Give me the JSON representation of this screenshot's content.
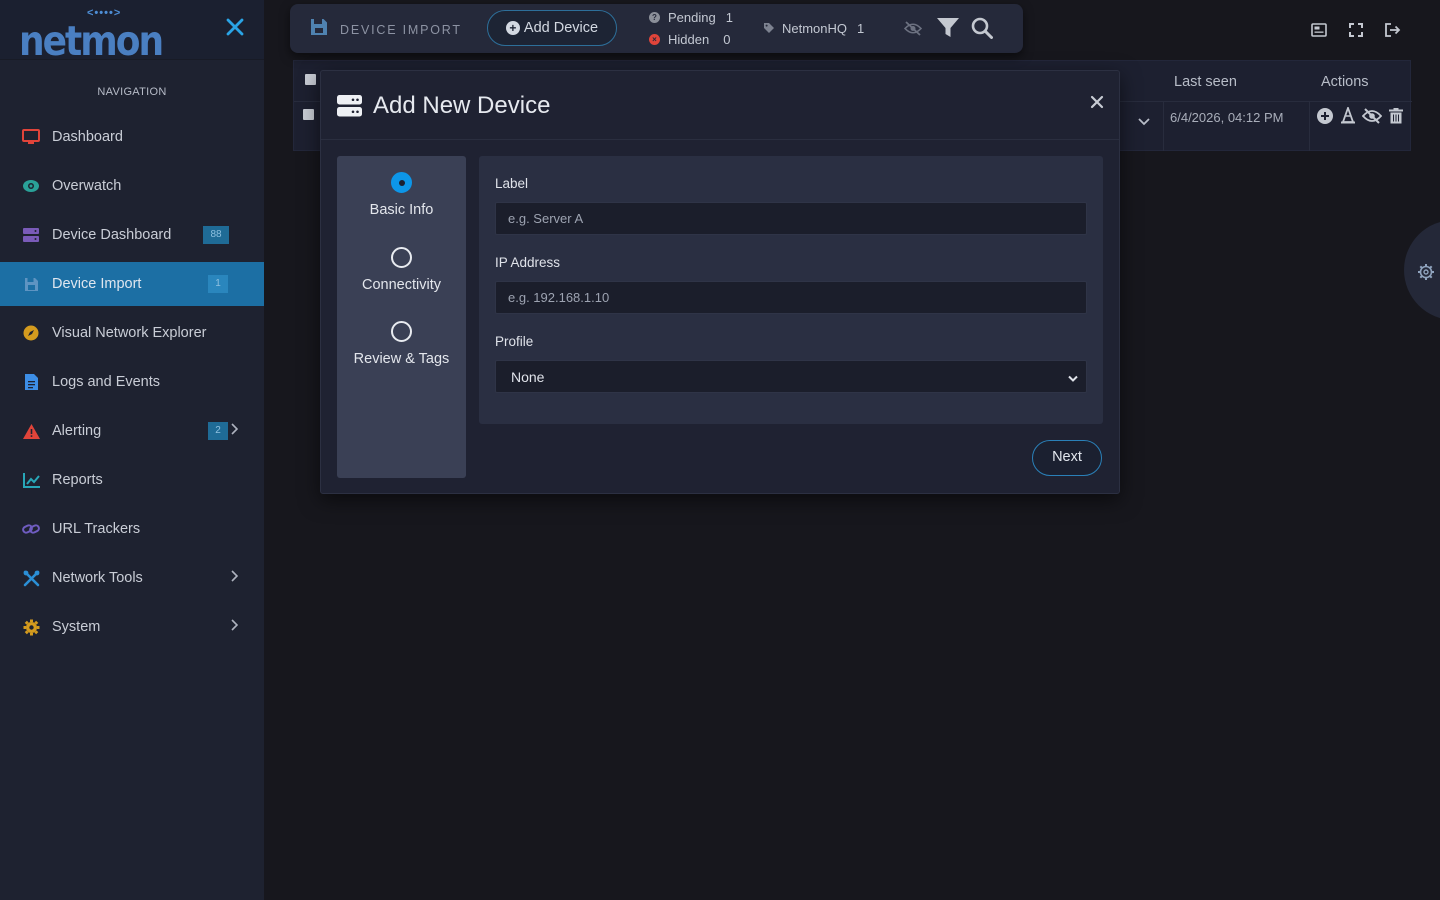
{
  "sidebar": {
    "logo_text": "netmon",
    "logo_dots": "<••••>",
    "heading": "NAVIGATION",
    "items": [
      {
        "label": "Dashboard",
        "icon": "monitor-icon",
        "color": "#e0443a"
      },
      {
        "label": "Overwatch",
        "icon": "eye-icon",
        "color": "#2aa198"
      },
      {
        "label": "Device Dashboard",
        "icon": "server-icon",
        "color": "#7a5bb8",
        "badge": "88"
      },
      {
        "label": "Device Import",
        "icon": "save-icon",
        "color": "#6fa0c8",
        "badge": "1",
        "active": true
      },
      {
        "label": "Visual Network Explorer",
        "icon": "compass-icon",
        "color": "#d49b1e"
      },
      {
        "label": "Logs and Events",
        "icon": "document-icon",
        "color": "#3d8ee6"
      },
      {
        "label": "Alerting",
        "icon": "warning-icon",
        "color": "#e0443a",
        "badge": "2"
      },
      {
        "label": "Reports",
        "icon": "chart-line-icon",
        "color": "#28a7b8"
      },
      {
        "label": "URL Trackers",
        "icon": "link-icon",
        "color": "#6f5cc0"
      },
      {
        "label": "Network Tools",
        "icon": "tools-icon",
        "color": "#2b8fd6"
      },
      {
        "label": "System",
        "icon": "gear-icon",
        "color": "#d49b1e"
      }
    ]
  },
  "toolbar": {
    "title": "DEVICE IMPORT",
    "add_button": "Add Device",
    "pending_label": "Pending",
    "pending_count": "1",
    "hidden_label": "Hidden",
    "hidden_count": "0",
    "tag_label": "NetmonHQ",
    "tag_count": "1"
  },
  "table": {
    "col_last_seen": "Last seen",
    "col_actions": "Actions",
    "row_last_seen": "6/4/2026, 04:12 PM"
  },
  "modal": {
    "title": "Add New Device",
    "steps": [
      "Basic Info",
      "Connectivity",
      "Review & Tags"
    ],
    "label_field": "Label",
    "label_placeholder": "e.g. Server A",
    "ip_field": "IP Address",
    "ip_placeholder": "e.g. 192.168.1.10",
    "profile_field": "Profile",
    "profile_value": "None",
    "next_button": "Next"
  },
  "colors": {
    "accent": "#0d96e8",
    "active_nav": "#1c6fa4",
    "pending_dot": "#8b8f99",
    "hidden_dot": "#e0443a"
  }
}
